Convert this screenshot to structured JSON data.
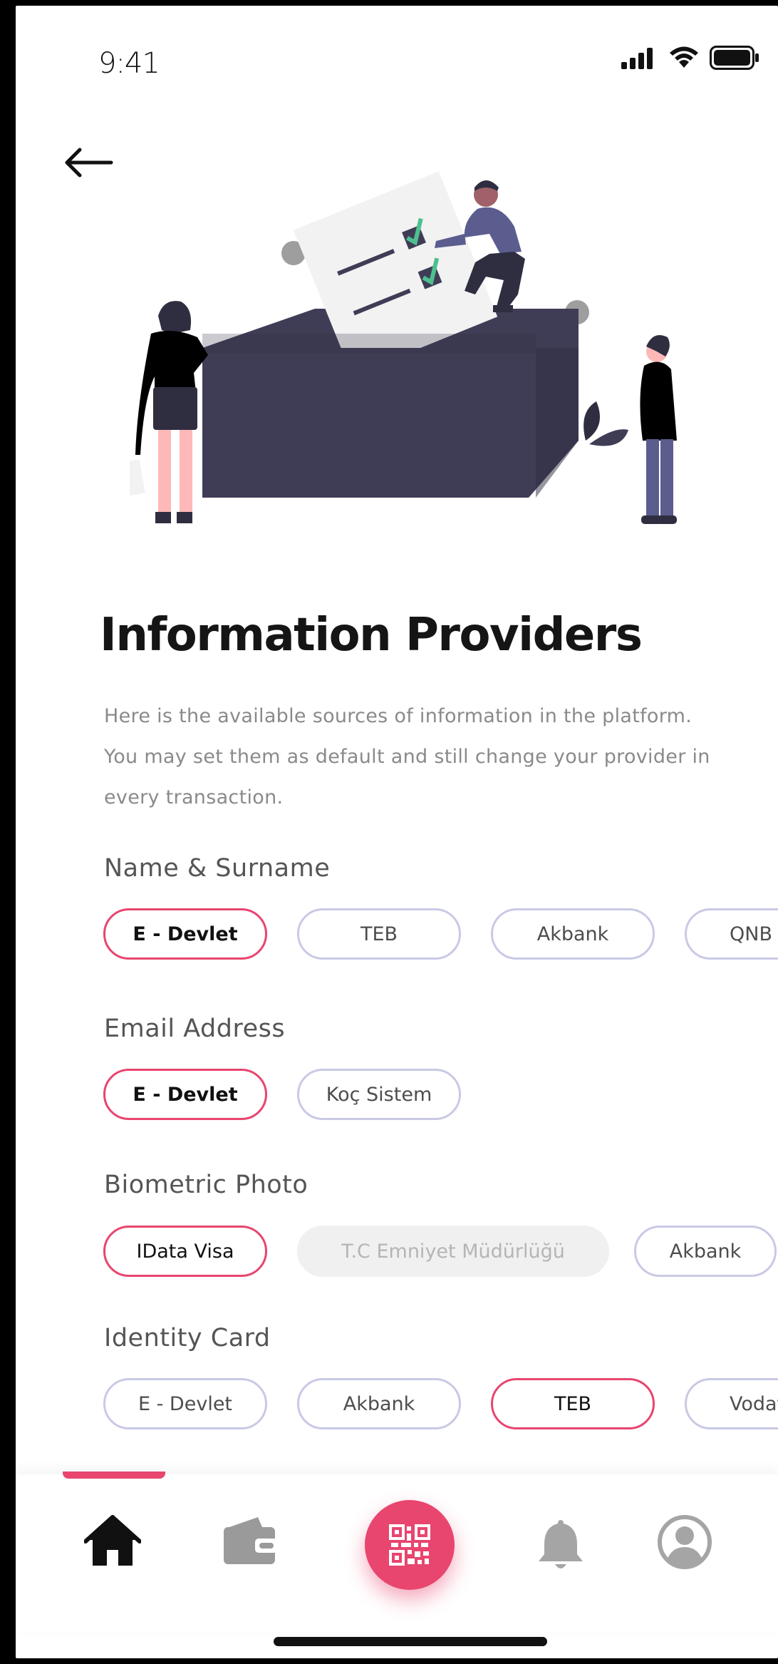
{
  "status_bar": {
    "time": "9:41"
  },
  "header": {
    "back_icon": "arrow-left-icon"
  },
  "page": {
    "title": "Information Providers",
    "description": "Here is the available sources of information in the platform. You may set them as default and still change your provider in every transaction."
  },
  "sections": [
    {
      "label": "Name & Surname",
      "options": [
        {
          "label": "E - Devlet",
          "state": "selected"
        },
        {
          "label": "TEB",
          "state": "default"
        },
        {
          "label": "Akbank",
          "state": "default"
        },
        {
          "label": "QNB",
          "state": "default"
        }
      ]
    },
    {
      "label": "Email Address",
      "options": [
        {
          "label": "E - Devlet",
          "state": "selected"
        },
        {
          "label": "Koç Sistem",
          "state": "default"
        }
      ]
    },
    {
      "label": "Biometric Photo",
      "options": [
        {
          "label": "IData Visa",
          "state": "selected"
        },
        {
          "label": "T.C Emniyet Müdürlüğü",
          "state": "disabled"
        },
        {
          "label": "Akbank",
          "state": "default"
        }
      ]
    },
    {
      "label": "Identity Card",
      "options": [
        {
          "label": "E - Devlet",
          "state": "default"
        },
        {
          "label": "Akbank",
          "state": "default"
        },
        {
          "label": "TEB",
          "state": "selected"
        },
        {
          "label": "Vodaf",
          "state": "default"
        }
      ]
    }
  ],
  "bottom_nav": {
    "active": "home",
    "items": [
      "home-icon",
      "wallet-icon",
      "qr-code-icon",
      "bell-icon",
      "profile-icon"
    ]
  },
  "colors": {
    "accent": "#e8456f",
    "chip_border": "#c9c9e6",
    "illustration_dark": "#3f3d56",
    "illustration_purple": "#5b5d8f",
    "check_green": "#4fbf8f"
  }
}
